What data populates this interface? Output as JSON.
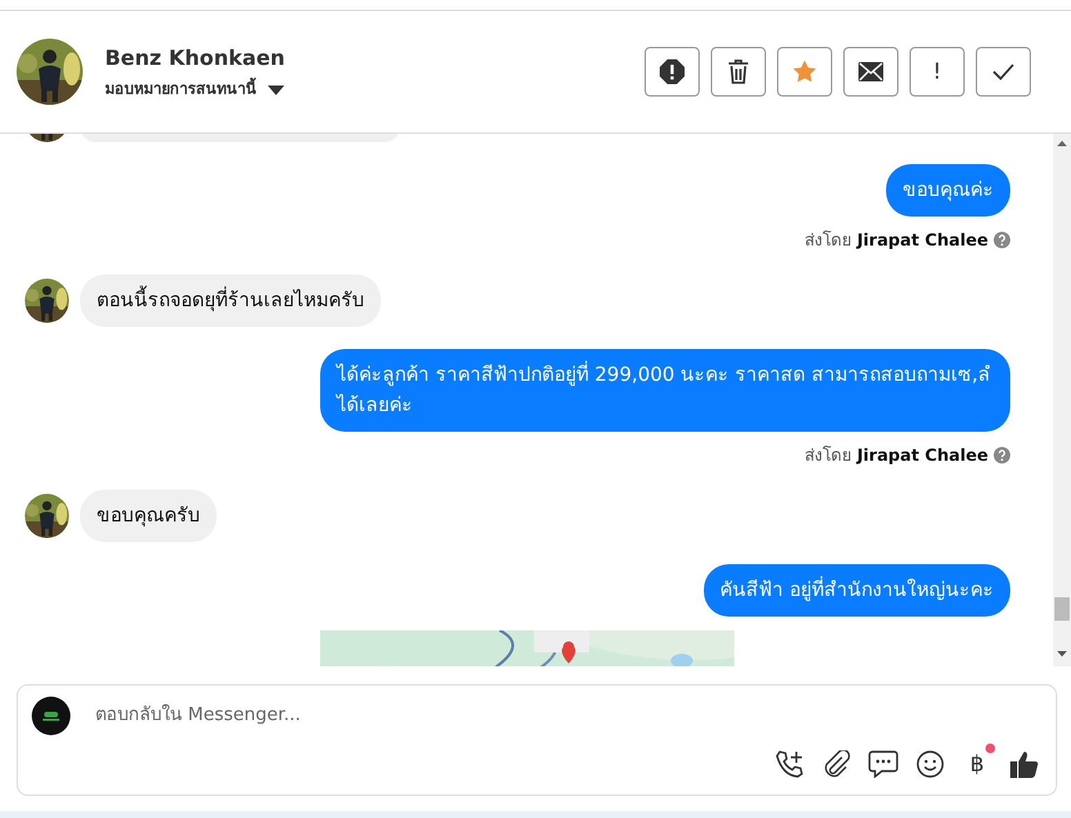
{
  "contact": {
    "name": "Benz Khonkaen",
    "assign_label": "มอบหมายการสนทนานี้"
  },
  "toolbar": [
    {
      "kind": "spam"
    },
    {
      "kind": "delete"
    },
    {
      "kind": "star",
      "on": true
    },
    {
      "kind": "mail"
    },
    {
      "kind": "text",
      "label": "!"
    },
    {
      "kind": "done"
    }
  ],
  "messages": [
    {
      "kind": "partial_in"
    },
    {
      "kind": "out",
      "text": "ขอบคุณค่ะ",
      "sent_label": "ส่งโดย",
      "sender": "Jirapat Chalee"
    },
    {
      "kind": "in",
      "text": "ตอนนี้รถจอดยุที่ร้านเลยไหมครับ"
    },
    {
      "kind": "out",
      "text": "ได้ค่ะลูกค้า  ราคาสีฟ้าปกติอยู่ที่ 299,000 นะคะ ราคาสด สามารถสอบถามเซ,ลํได้เลยค่ะ",
      "sent_label": "ส่งโดย",
      "sender": "Jirapat Chalee"
    },
    {
      "kind": "in",
      "text": "ขอบคุณครับ"
    },
    {
      "kind": "out",
      "text": "คันสีฟ้า อยู่ที่สำนักงานใหญ่นะคะ"
    },
    {
      "kind": "map"
    }
  ],
  "composer": {
    "placeholder": "ตอบกลับใน Messenger...",
    "tools": [
      {
        "kind": "call"
      },
      {
        "kind": "attach"
      },
      {
        "kind": "reply"
      },
      {
        "kind": "emoji"
      },
      {
        "kind": "text",
        "label": "฿",
        "badge": true
      },
      {
        "kind": "like"
      }
    ]
  }
}
